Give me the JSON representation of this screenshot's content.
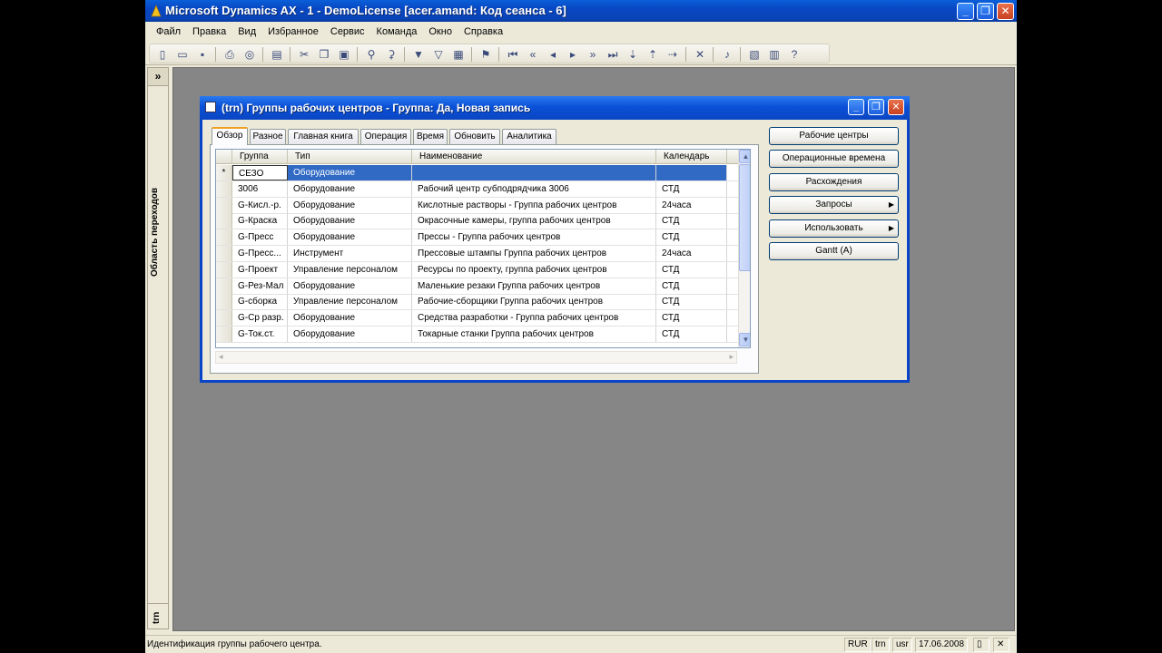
{
  "window": {
    "title": "Microsoft Dynamics AX - 1 - DemoLicense [acer.amand: Код сеанса - 6]",
    "minimize": "_",
    "restore": "❐",
    "close": "✕"
  },
  "menu": [
    "Файл",
    "Правка",
    "Вид",
    "Избранное",
    "Сервис",
    "Команда",
    "Окно",
    "Справка"
  ],
  "toolbar_icons": [
    "new-icon",
    "open-icon",
    "save-icon",
    "print-icon",
    "print-preview-icon",
    "form-icon",
    "cut-icon",
    "copy-icon",
    "paste-icon",
    "find-icon",
    "filter-icon",
    "filter-selection-icon",
    "filter-advanced-icon",
    "sort-icon",
    "remove-filter-icon",
    "first-record-icon",
    "prev-page-icon",
    "prev-record-icon",
    "next-record-icon",
    "next-page-icon",
    "last-record-icon",
    "export-icon",
    "import-icon",
    "export-excel-icon",
    "delete-icon",
    "alert-icon",
    "document-icon",
    "report-icon",
    "help-icon"
  ],
  "nav": {
    "toggle": "»",
    "label": "Область переходов",
    "company": "trn"
  },
  "form": {
    "title": "(trn) Группы рабочих центров - Группа: Да, Новая запись",
    "minimize": "_",
    "restore": "❐",
    "close": "✕",
    "tabs": [
      "Обзор",
      "Разное",
      "Главная книга",
      "Операция",
      "Время",
      "Обновить",
      "Аналитика"
    ],
    "columns": [
      "Группа",
      "Тип",
      "Наименование",
      "Календарь"
    ],
    "new_row_marker": "*",
    "rows": [
      [
        "СЕЗО",
        "Оборудование",
        "",
        ""
      ],
      [
        "3006",
        "Оборудование",
        "Рабочий центр субподрядчика 3006",
        "СТД"
      ],
      [
        "G-Кисл.-р.",
        "Оборудование",
        "Кислотные растворы - Группа рабочих центров",
        "24часа"
      ],
      [
        "G-Краска",
        "Оборудование",
        "Окрасочные камеры, группа рабочих центров",
        "СТД"
      ],
      [
        "G-Пресс",
        "Оборудование",
        "Прессы - Группа рабочих центров",
        "СТД"
      ],
      [
        "G-Пресс...",
        "Инструмент",
        "Прессовые штампы Группа рабочих центров",
        "24часа"
      ],
      [
        "G-Проект",
        "Управление персоналом",
        "Ресурсы по проекту, группа рабочих центров",
        "СТД"
      ],
      [
        "G-Рез-Мал",
        "Оборудование",
        "Маленькие резаки Группа рабочих центров",
        "СТД"
      ],
      [
        "G-сборка",
        "Управление персоналом",
        "Рабочие-сборщики Группа рабочих центров",
        "СТД"
      ],
      [
        "G-Ср разр.",
        "Оборудование",
        "Средства разработки - Группа рабочих центров",
        "СТД"
      ],
      [
        "G-Ток.ст.",
        "Оборудование",
        "Токарные станки Группа рабочих центров",
        "СТД"
      ]
    ],
    "buttons": [
      "Рабочие центры",
      "Операционные времена",
      "Расхождения",
      "Запросы",
      "Использовать",
      "Gantt (A)"
    ]
  },
  "status": {
    "message": "Идентификация группы рабочего центра.",
    "currency": "RUR",
    "company": "trn",
    "layer": "usr",
    "date": "17.06.2008"
  },
  "colors": {
    "titlebar": "#0a50d8",
    "selection": "#316ac5",
    "workspace": "#868686"
  }
}
